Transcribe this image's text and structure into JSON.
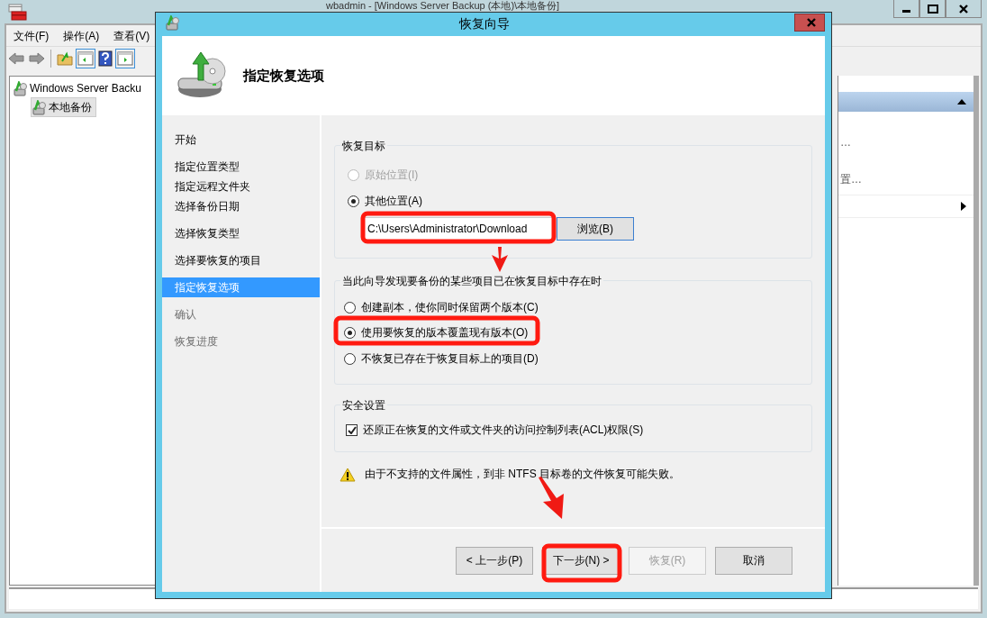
{
  "app": {
    "title": "wbadmin - [Windows Server Backup (本地)\\本地备份]",
    "menu": [
      "文件(F)",
      "操作(A)",
      "查看(V)"
    ],
    "tree": [
      {
        "label": "Windows Server Backu",
        "selected": false,
        "children": [
          {
            "label": "本地备份",
            "selected": true
          }
        ]
      }
    ],
    "actions": [
      {
        "label": "…",
        "kind": "item"
      },
      {
        "label": "置…",
        "kind": "item"
      },
      {
        "kind": "submenu"
      }
    ]
  },
  "dialog": {
    "title": "恢复向导",
    "heading": "指定恢复选项",
    "step_groups": [
      {
        "steps": [
          {
            "label": "开始",
            "selected": false,
            "disabled": false
          }
        ]
      },
      {
        "steps": [
          {
            "label": "指定位置类型",
            "selected": false,
            "disabled": false
          },
          {
            "label": "指定远程文件夹",
            "selected": false,
            "disabled": false
          },
          {
            "label": "选择备份日期",
            "selected": false,
            "disabled": false
          }
        ]
      },
      {
        "steps": [
          {
            "label": "选择恢复类型",
            "selected": false,
            "disabled": false
          }
        ]
      },
      {
        "steps": [
          {
            "label": "选择要恢复的项目",
            "selected": false,
            "disabled": false
          }
        ]
      },
      {
        "steps": [
          {
            "label": "指定恢复选项",
            "selected": true,
            "disabled": false
          }
        ]
      },
      {
        "steps": [
          {
            "label": "确认",
            "selected": false,
            "disabled": true
          }
        ]
      },
      {
        "steps": [
          {
            "label": "恢复进度",
            "selected": false,
            "disabled": true
          }
        ]
      }
    ],
    "target": {
      "legend": "恢复目标",
      "options": [
        {
          "label": "原始位置(I)",
          "selected": false,
          "disabled": true
        },
        {
          "label": "其他位置(A)",
          "selected": true,
          "disabled": false
        }
      ],
      "path": "C:\\Users\\Administrator\\Download",
      "browse": "浏览(B)"
    },
    "conflict": {
      "legend": "当此向导发现要备份的某些项目已在恢复目标中存在时",
      "options": [
        {
          "label": "创建副本，使你同时保留两个版本(C)",
          "selected": false
        },
        {
          "label": "使用要恢复的版本覆盖现有版本(O)",
          "selected": true
        },
        {
          "label": "不恢复已存在于恢复目标上的项目(D)",
          "selected": false
        }
      ]
    },
    "security": {
      "legend": "安全设置",
      "checkbox": {
        "label": "还原正在恢复的文件或文件夹的访问控制列表(ACL)权限(S)",
        "checked": true
      }
    },
    "warning": "由于不支持的文件属性，到非 NTFS 目标卷的文件恢复可能失败。",
    "buttons": [
      {
        "label": "< 上一步(P)",
        "disabled": false
      },
      {
        "label": "下一步(N) >",
        "disabled": false
      },
      {
        "label": "恢复(R)",
        "disabled": true
      },
      {
        "label": "取消",
        "disabled": false
      }
    ]
  }
}
